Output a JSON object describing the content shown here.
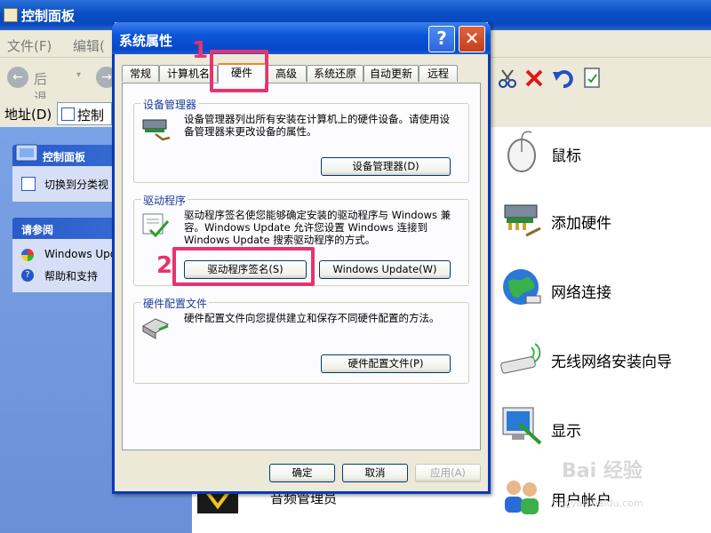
{
  "control_panel": {
    "title": "控制面板",
    "menu": [
      "文件(F)",
      "编辑("
    ],
    "toolbar": {
      "back_label": "后退",
      "back_arrow": "←",
      "forward_arrow": "→"
    },
    "address": {
      "label": "地址(D)",
      "value": "控制"
    },
    "left_panel": {
      "section1_title": "控制面板",
      "section1_link": "切换到分类视",
      "section2_title": "请参阅",
      "section2_links": [
        "Windows Upd",
        "帮助和支持"
      ]
    },
    "items": [
      {
        "label": "鼠标",
        "icon": "mouse-icon"
      },
      {
        "label": "添加硬件",
        "icon": "add-hardware-icon"
      },
      {
        "label": "网络连接",
        "icon": "network-icon"
      },
      {
        "label": "无线网络安装向导",
        "icon": "wireless-icon"
      },
      {
        "label": "显示",
        "icon": "display-icon"
      },
      {
        "label": "用户帐户",
        "icon": "users-icon"
      }
    ],
    "bottom_item_label": "音频管理员",
    "watermark": "Bai 经验",
    "watermark_sub": "jingyan.baidu.com"
  },
  "dialog": {
    "title": "系统属性",
    "help_glyph": "?",
    "close_glyph": "✕",
    "tabs": [
      "常规",
      "计算机名",
      "硬件",
      "高级",
      "系统还原",
      "自动更新",
      "远程"
    ],
    "active_tab": "硬件",
    "device_manager": {
      "group_label": "设备管理器",
      "text": "设备管理器列出所有安装在计算机上的硬件设备。请使用设备管理器来更改设备的属性。",
      "button": "设备管理器(D)"
    },
    "drivers": {
      "group_label": "驱动程序",
      "text": "驱动程序签名使您能够确定安装的驱动程序与 Windows 兼容。Windows Update 允许您设置 Windows 连接到 Windows Update 搜索驱动程序的方式。",
      "signing_button": "驱动程序签名(S)",
      "update_button": "Windows Update(W)"
    },
    "hardware_profiles": {
      "group_label": "硬件配置文件",
      "text": "硬件配置文件向您提供建立和保存不同硬件配置的方法。",
      "button": "硬件配置文件(P)"
    },
    "ok_button": "确定",
    "cancel_button": "取消",
    "apply_button": "应用(A)"
  },
  "annotations": {
    "step1": "1",
    "step2": "2"
  },
  "colors": {
    "highlight": "#e8336f",
    "titlebar": "#0a56d8"
  }
}
